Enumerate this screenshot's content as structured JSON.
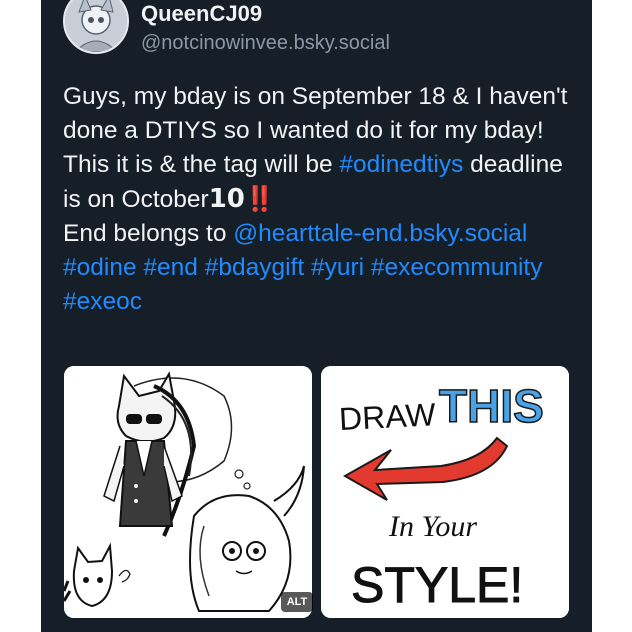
{
  "author": {
    "display_name": "QueenCJ09",
    "handle": "@notcinowinvee.bsky.social"
  },
  "post": {
    "line1": "Guys, my bday is on September 18 & I haven't done a DTIYS so I wanted do it for my bday! This it is & the tag will be",
    "tag_main": "#odinedtiys",
    "deadline_text": " deadline is on October",
    "deadline_day": "10",
    "deadline_bang": "‼️",
    "end_text": "End belongs to ",
    "mention": "@hearttale-end.bsky.social",
    "tags": [
      "#odine",
      "#end",
      "#bdaygift",
      "#yuri",
      "#execommunity",
      "#exeoc"
    ]
  },
  "images": {
    "alt_badge": "ALT",
    "draw_this": {
      "word1": "DRAW",
      "word2": "THIS",
      "word3": "In Your",
      "word4": "STYLE!"
    }
  },
  "colors": {
    "background": "#161e27",
    "text": "#f1f3f5",
    "muted": "#8b98a8",
    "link": "#208bfe",
    "arrow": "#e23a2e",
    "accent_blue": "#4aa3e8"
  }
}
